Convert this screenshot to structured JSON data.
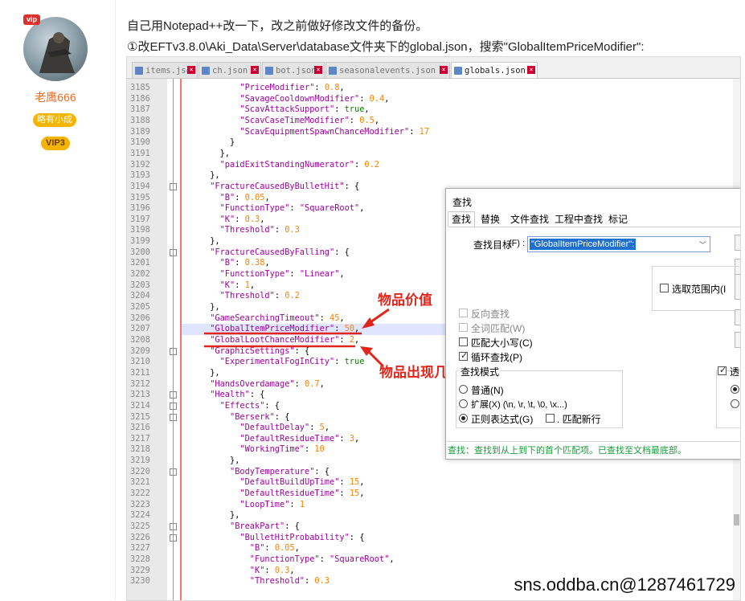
{
  "sidebar": {
    "vip_tag": "vip",
    "username": "老鹰666",
    "rank": "略有小成",
    "vip_level": "VIP3"
  },
  "post": {
    "line1": "自己用Notepad++改一下，改之前做好修改文件的备份。",
    "line2": "①改EFTv3.8.0\\Aki_Data\\Server\\database文件夹下的global.json，搜索\"GlobalItemPriceModifier\":"
  },
  "editor": {
    "tabs": [
      "items.json",
      "ch.json",
      "bot.json",
      "seasonalevents.json",
      "globals.json"
    ],
    "active_tab": 4,
    "lines": [
      {
        "n": "3185",
        "t": "            \"PriceModifier\": 0.8,"
      },
      {
        "n": "3186",
        "t": "            \"SavageCooldownModifier\": 0.4,"
      },
      {
        "n": "3187",
        "t": "            \"ScavAttackSupport\": true,"
      },
      {
        "n": "3188",
        "t": "            \"ScavCaseTimeModifier\": 0.5,"
      },
      {
        "n": "3189",
        "t": "            \"ScavEquipmentSpawnChanceModifier\": 17"
      },
      {
        "n": "3190",
        "t": "          }"
      },
      {
        "n": "3191",
        "t": "        },"
      },
      {
        "n": "3192",
        "t": "        \"paidExitStandingNumerator\": 0.2"
      },
      {
        "n": "3193",
        "t": "      },"
      },
      {
        "n": "3194",
        "t": "      \"FractureCausedByBulletHit\": {"
      },
      {
        "n": "3195",
        "t": "        \"B\": 0.05,"
      },
      {
        "n": "3196",
        "t": "        \"FunctionType\": \"SquareRoot\","
      },
      {
        "n": "3197",
        "t": "        \"K\": 0.3,"
      },
      {
        "n": "3198",
        "t": "        \"Threshold\": 0.3"
      },
      {
        "n": "3199",
        "t": "      },"
      },
      {
        "n": "3200",
        "t": "      \"FractureCausedByFalling\": {"
      },
      {
        "n": "3201",
        "t": "        \"B\": 0.38,"
      },
      {
        "n": "3202",
        "t": "        \"FunctionType\": \"Linear\","
      },
      {
        "n": "3203",
        "t": "        \"K\": 1,"
      },
      {
        "n": "3204",
        "t": "        \"Threshold\": 0.2"
      },
      {
        "n": "3205",
        "t": "      },"
      },
      {
        "n": "3206",
        "t": "      \"GameSearchingTimeout\": 45,"
      },
      {
        "n": "3207",
        "t": "      \"GlobalItemPriceModifier\": 50,"
      },
      {
        "n": "3208",
        "t": "      \"GlobalLootChanceModifier\": 2,"
      },
      {
        "n": "3209",
        "t": "      \"GraphicSettings\": {"
      },
      {
        "n": "3210",
        "t": "        \"ExperimentalFogInCity\": true"
      },
      {
        "n": "3211",
        "t": "      },"
      },
      {
        "n": "3212",
        "t": "      \"HandsOverdamage\": 0.7,"
      },
      {
        "n": "3213",
        "t": "      \"Health\": {"
      },
      {
        "n": "3214",
        "t": "        \"Effects\": {"
      },
      {
        "n": "3215",
        "t": "          \"Berserk\": {"
      },
      {
        "n": "3216",
        "t": "            \"DefaultDelay\": 5,"
      },
      {
        "n": "3217",
        "t": "            \"DefaultResidueTime\": 3,"
      },
      {
        "n": "3218",
        "t": "            \"WorkingTime\": 10"
      },
      {
        "n": "3219",
        "t": "          },"
      },
      {
        "n": "3220",
        "t": "          \"BodyTemperature\": {"
      },
      {
        "n": "3221",
        "t": "            \"DefaultBuildUpTime\": 15,"
      },
      {
        "n": "3222",
        "t": "            \"DefaultResidueTime\": 15,"
      },
      {
        "n": "3223",
        "t": "            \"LoopTime\": 1"
      },
      {
        "n": "3224",
        "t": "          },"
      },
      {
        "n": "3225",
        "t": "          \"BreakPart\": {"
      },
      {
        "n": "3226",
        "t": "            \"BulletHitProbability\": {"
      },
      {
        "n": "3227",
        "t": "              \"B\": 0.05,"
      },
      {
        "n": "3228",
        "t": "              \"FunctionType\": \"SquareRoot\","
      },
      {
        "n": "3229",
        "t": "              \"K\": 0.3,"
      },
      {
        "n": "3230",
        "t": "              \"Threshold\": 0.3"
      }
    ]
  },
  "find_dialog": {
    "title": "查找",
    "tabs": [
      "查找",
      "替换",
      "文件查找",
      "工程中查找",
      "标记"
    ],
    "find_label": "查找目标",
    "find_accel": "(F) :",
    "find_value": "\"GlobalItemPriceModifier\":",
    "in_selection": "选取范围内(I",
    "reverse": "反向查找",
    "whole_word": "全词匹配(W)",
    "match_case": "匹配大小写(C)",
    "wrap": "循环查找(P)",
    "mode_title": "查找模式",
    "mode_normal": "普通(N)",
    "mode_extended": "扩展(X) (\\n, \\r, \\t, \\0, \\x...)",
    "mode_regex": "正则表达式(G)",
    "dot_newline": ". 匹配新行",
    "status": "查找：查找到从上到下的首个匹配项。已查找至文档最底部。",
    "side_checkbox": "透"
  },
  "annotations": {
    "price": "物品价值",
    "loot": "物品出现几率"
  },
  "watermark": "sns.oddba.cn@1287461729"
}
